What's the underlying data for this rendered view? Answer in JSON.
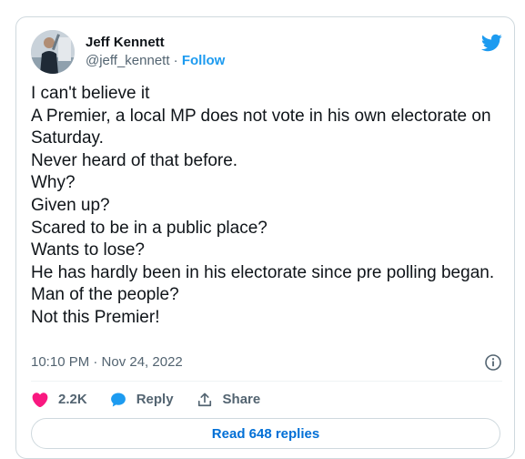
{
  "author": {
    "display_name": "Jeff Kennett",
    "handle": "@jeff_kennett",
    "separator": " · ",
    "follow_label": "Follow",
    "avatar_icon": "avatar-photo",
    "brand_icon": "twitter-bird-icon"
  },
  "tweet": {
    "text": "I can't believe it\nA Premier, a local MP does not vote in his own electorate on Saturday.\nNever heard of that before.\nWhy?\nGiven up?\nScared to be in a public place?\nWants to lose?\nHe has hardly been in his electorate since pre polling began.\nMan of the people?\nNot this Premier!",
    "timestamp": "10:10 PM · Nov 24, 2022"
  },
  "actions": {
    "like_count": "2.2K",
    "reply_label": "Reply",
    "share_label": "Share"
  },
  "footer": {
    "read_replies_label": "Read 648 replies"
  },
  "colors": {
    "accent": "#1d9bf0",
    "like": "#f91880",
    "text": "#0f1419",
    "secondary": "#536471",
    "border": "#cfd9de"
  }
}
